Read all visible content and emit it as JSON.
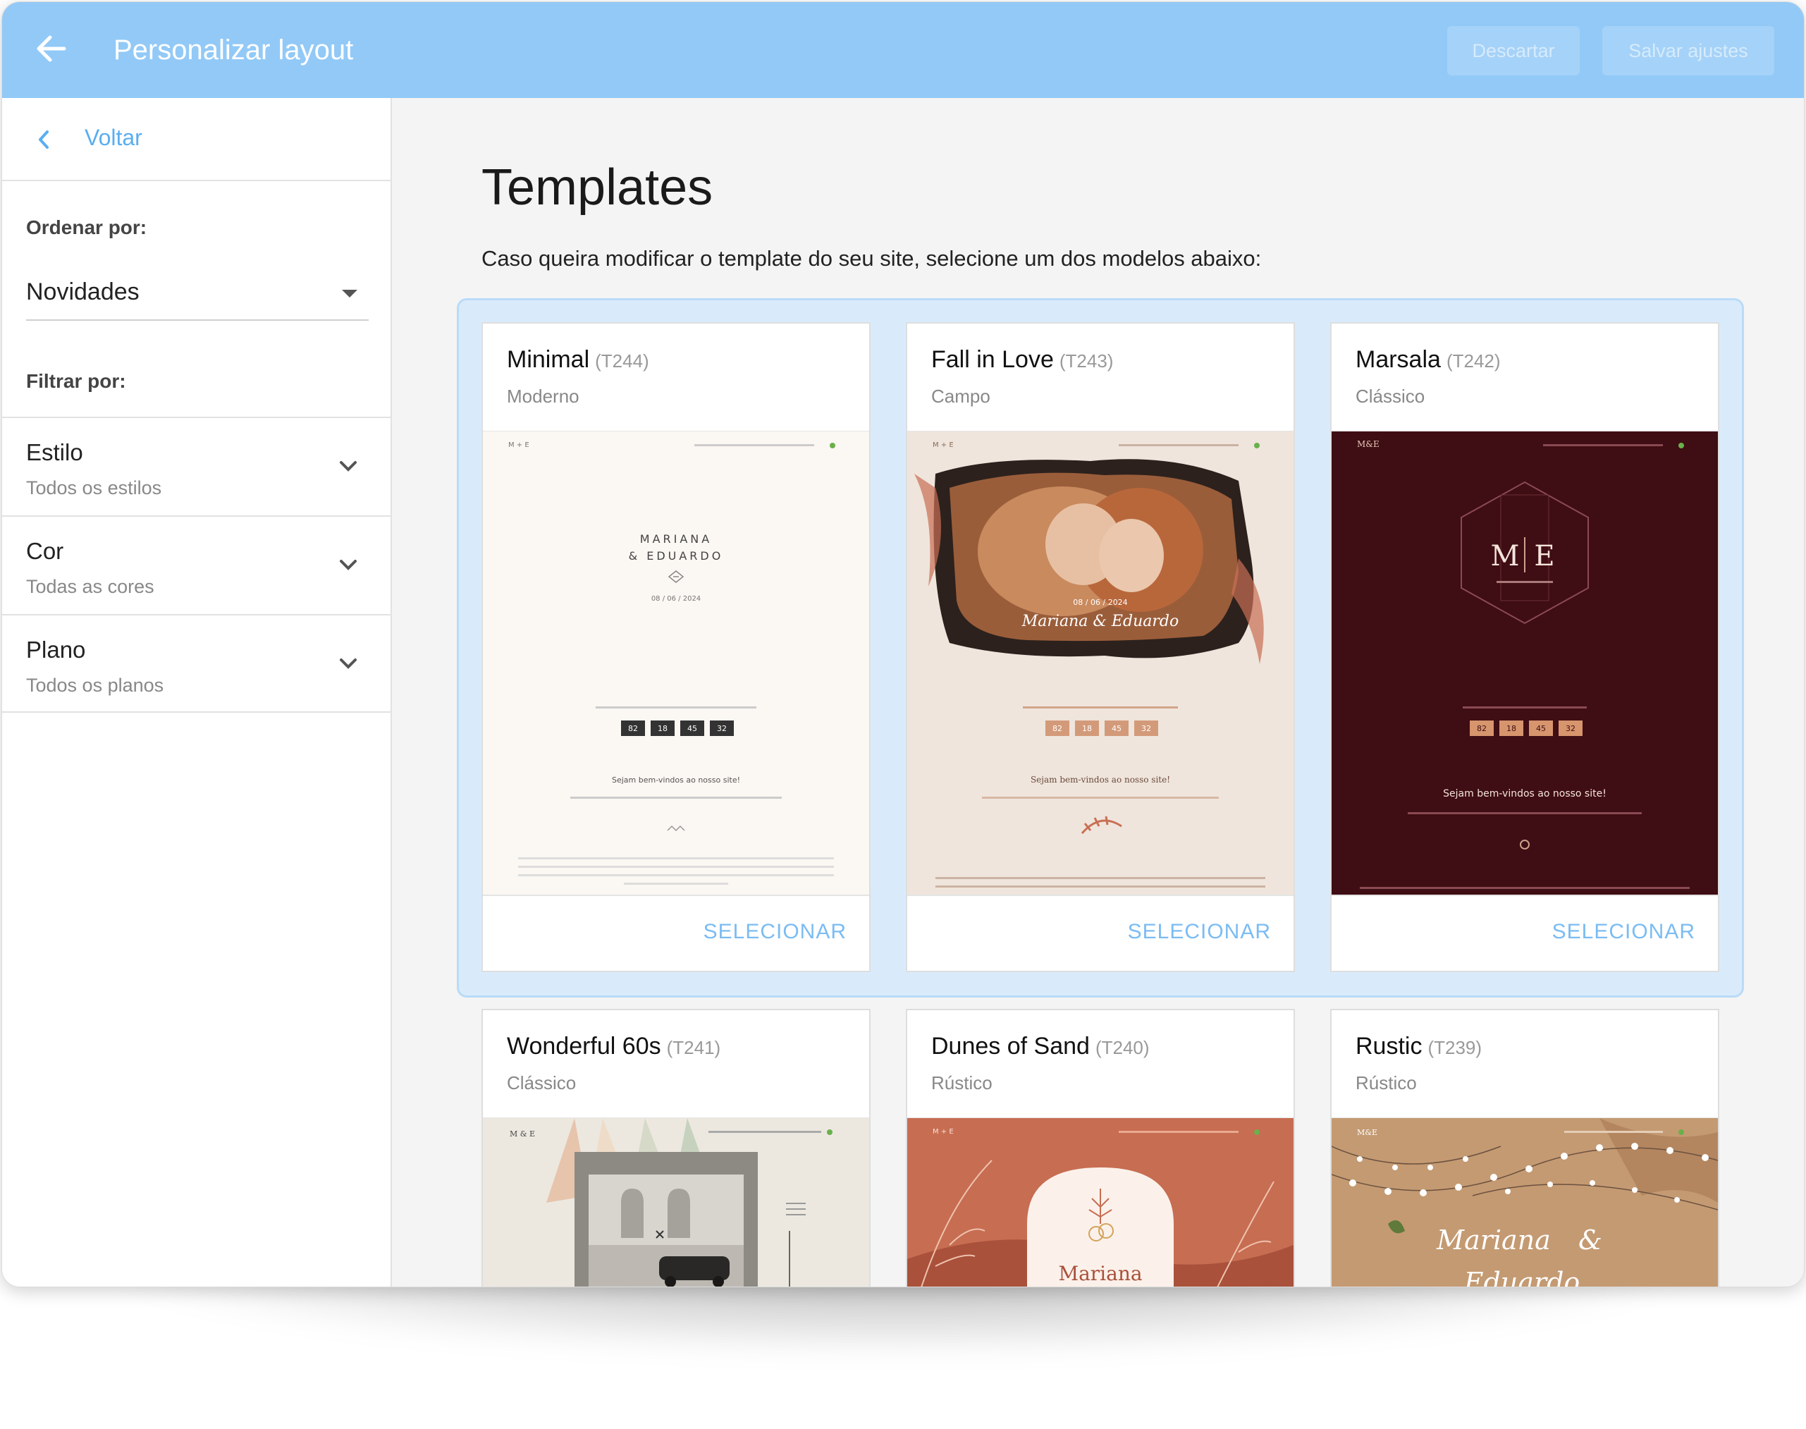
{
  "header": {
    "title": "Personalizar layout",
    "discard_label": "Descartar",
    "save_label": "Salvar ajustes",
    "bg_color": "#92c9f7"
  },
  "sidebar": {
    "back_label": "Voltar",
    "sort_label": "Ordenar por:",
    "sort_value": "Novidades",
    "filter_label": "Filtrar por:",
    "filters": [
      {
        "title": "Estilo",
        "value": "Todos os estilos"
      },
      {
        "title": "Cor",
        "value": "Todas as cores"
      },
      {
        "title": "Plano",
        "value": "Todos os planos"
      }
    ]
  },
  "main": {
    "title": "Templates",
    "description": "Caso queira modificar o template do seu site, selecione um dos modelos abaixo:",
    "select_label": "SELECIONAR",
    "templates": [
      {
        "name": "Minimal",
        "code": "(T244)",
        "category": "Moderno",
        "preview": {
          "brand": "M + E",
          "names_line1": "MARIANA",
          "names_line2": "& EDUARDO",
          "date": "08 / 06 / 2024",
          "countdown": [
            "82",
            "18",
            "45",
            "32"
          ],
          "welcome": "Sejam bem-vindos ao nosso site!"
        }
      },
      {
        "name": "Fall in Love",
        "code": "(T243)",
        "category": "Campo",
        "preview": {
          "brand": "M + E",
          "date": "08 / 06 / 2024",
          "names": "Mariana & Eduardo",
          "countdown": [
            "82",
            "18",
            "45",
            "32"
          ],
          "welcome": "Sejam bem-vindos ao nosso site!"
        }
      },
      {
        "name": "Marsala",
        "code": "(T242)",
        "category": "Clássico",
        "preview": {
          "brand": "M&E",
          "monogram_left": "M",
          "monogram_right": "E",
          "countdown": [
            "82",
            "18",
            "45",
            "32"
          ],
          "welcome": "Sejam bem-vindos ao nosso site!"
        }
      },
      {
        "name": "Wonderful 60s",
        "code": "(T241)",
        "category": "Clássico",
        "preview": {
          "brand": "M & E"
        }
      },
      {
        "name": "Dunes of Sand",
        "code": "(T240)",
        "category": "Rústico",
        "preview": {
          "brand": "M + E",
          "name": "Mariana"
        }
      },
      {
        "name": "Rustic",
        "code": "(T239)",
        "category": "Rústico",
        "preview": {
          "brand": "M&E",
          "names_line1": "Mariana",
          "amp": "&",
          "names_line2": "Eduardo"
        }
      }
    ]
  }
}
